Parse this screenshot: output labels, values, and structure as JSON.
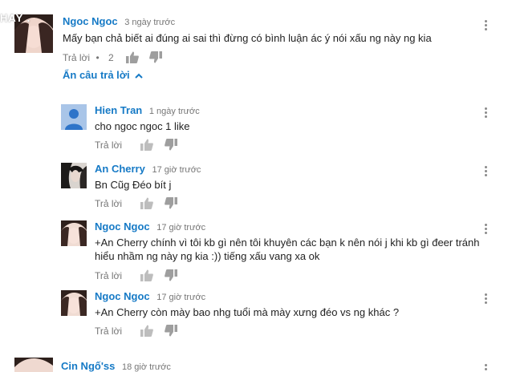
{
  "watermark": "HAY .",
  "top_comment": {
    "author": "Ngoc Ngoc",
    "time": "3 ngày trước",
    "text": "Mấy bạn chả biết ai đúng ai sai thì đừng có bình luận ác ý nói xấu ng này ng kia",
    "reply_label": "Trả lời",
    "separator": "•",
    "like_count": "2",
    "hide_replies_label": "Ẩn câu trả lời"
  },
  "replies": [
    {
      "author": "Hien Tran",
      "time": "1 ngày trước",
      "text": "cho ngoc ngoc 1 like",
      "reply_label": "Trả lời"
    },
    {
      "author": "An Cherry",
      "time": "17 giờ trước",
      "text": "Bn Cũg Đéo bít j",
      "reply_label": "Trả lời"
    },
    {
      "author": "Ngoc Ngoc",
      "time": "17 giờ trước",
      "text_line1": "+An Cherry chính vì tôi kb gì nên tôi khuyên các bạn k nên nói j khi kb gì đeer tránh",
      "text_line2": "hiểu nhầm ng này ng kia  :)) tiếng xấu vang xa ok",
      "reply_label": "Trả lời"
    },
    {
      "author": "Ngoc Ngoc",
      "time": "17 giờ trước",
      "text": "+An Cherry còn mày bao nhg tuổi mà mày xưng đéo vs ng khác ?",
      "reply_label": "Trả lời"
    }
  ],
  "next_comment": {
    "author": "Cin Ngố'ss",
    "time": "18 giờ trước"
  },
  "colors": {
    "author": "#167ac6",
    "meta": "#767676",
    "icon": "#9e9e9e"
  },
  "icons": [
    "thumb-up-icon",
    "thumb-down-icon",
    "more-vert-icon",
    "chevron-up-icon",
    "default-avatar-icon"
  ]
}
